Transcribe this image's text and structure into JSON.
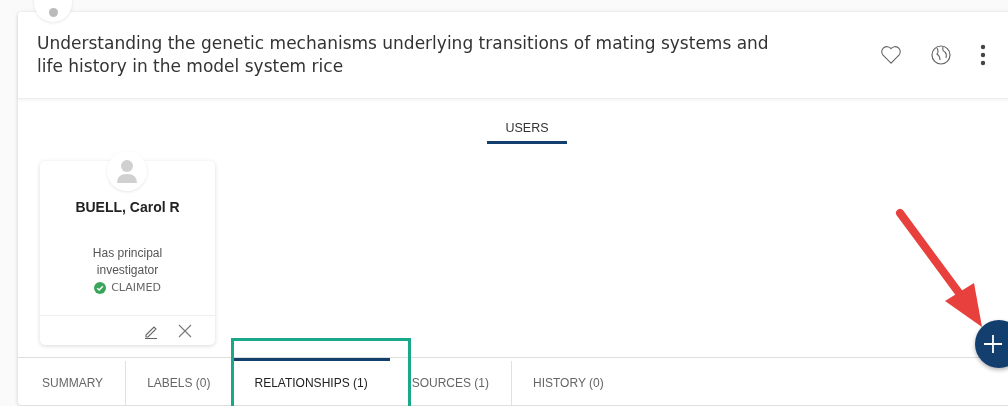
{
  "title": "Understanding the genetic mechanisms underlying transitions of mating systems and life history in the model system rice",
  "section_tabs": [
    {
      "label": "USERS",
      "selected": true
    }
  ],
  "user_cards": [
    {
      "name": "BUELL, Carol R",
      "role": "Has principal investigator",
      "status": "CLAIMED",
      "claimed": true
    }
  ],
  "bottom_tabs": [
    {
      "label": "SUMMARY",
      "selected": false
    },
    {
      "label": "LABELS (0)",
      "selected": false
    },
    {
      "label": "RELATIONSHIPS (1)",
      "selected": true
    },
    {
      "label": "SOURCES (1)",
      "selected": false
    },
    {
      "label": "HISTORY (0)",
      "selected": false
    }
  ]
}
